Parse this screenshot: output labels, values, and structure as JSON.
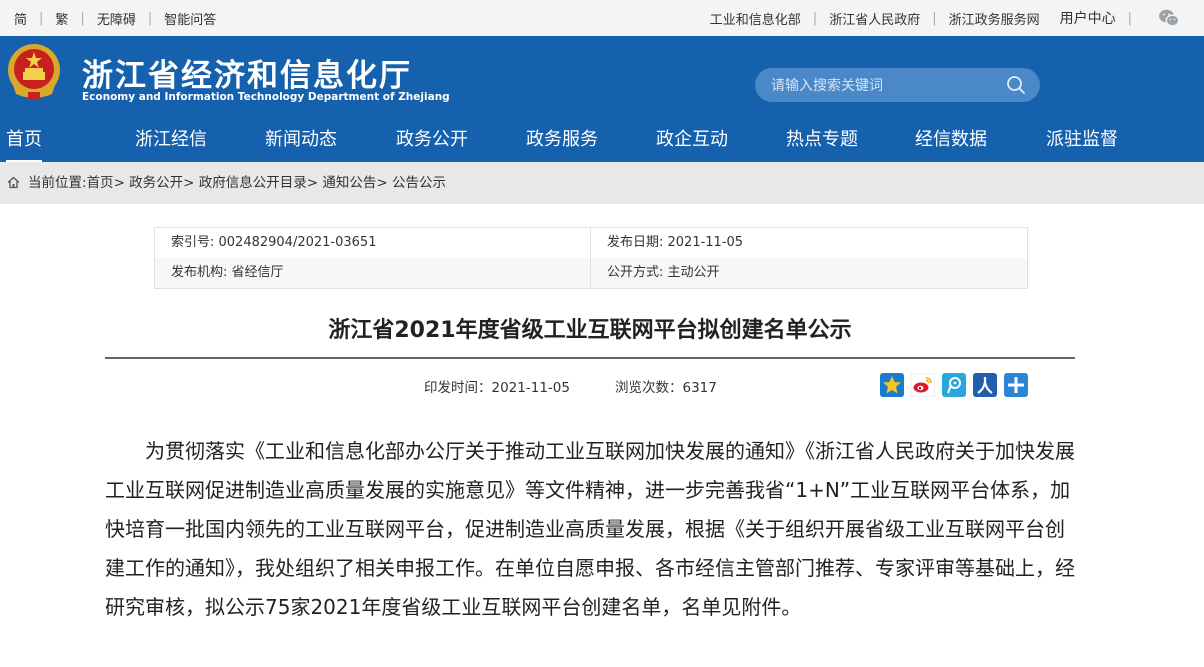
{
  "topbar": {
    "simplified": "简",
    "traditional": "繁",
    "accessibility": "无障碍",
    "smart_qa": "智能问答",
    "link_miit": "工业和信息化部",
    "link_zj_gov": "浙江省人民政府",
    "link_zj_service": "浙江政务服务网",
    "user_center": "用户中心"
  },
  "header": {
    "title": "浙江省经济和信息化厅",
    "subtitle": "Economy and Information Technology Department of Zhejiang",
    "search_placeholder": "请输入搜索关键词"
  },
  "nav": {
    "items": [
      "首页",
      "浙江经信",
      "新闻动态",
      "政务公开",
      "政务服务",
      "政企互动",
      "热点专题",
      "经信数据",
      "派驻监督"
    ]
  },
  "breadcrumb": {
    "prefix": "当前位置:",
    "items": [
      "首页",
      "政务公开",
      "政府信息公开目录",
      "通知公告",
      "公告公示"
    ]
  },
  "meta": {
    "index_no": "索引号: 002482904/2021-03651",
    "publish_date": "发布日期: 2021-11-05",
    "issuer": "发布机构: 省经信厅",
    "disclosure": "公开方式: 主动公开"
  },
  "article": {
    "title": "浙江省2021年度省级工业互联网平台拟创建名单公示",
    "issued_time": "印发时间：2021-11-05",
    "views": "浏览次数：6317",
    "body": "为贯彻落实《工业和信息化部办公厅关于推动工业互联网加快发展的通知》《浙江省人民政府关于加快发展工业互联网促进制造业高质量发展的实施意见》等文件精神，进一步完善我省“1+N”工业互联网平台体系，加快培育一批国内领先的工业互联网平台，促进制造业高质量发展，根据《关于组织开展省级工业互联网平台创建工作的通知》，我处组织了相关申报工作。在单位自愿申报、各市经信主管部门推荐、专家评审等基础上，经研究审核，拟公示75家2021年度省级工业互联网平台创建名单，名单见附件。"
  },
  "share_icons": [
    "qzone-icon",
    "weibo-icon",
    "tencent-weibo-icon",
    "renren-icon",
    "more-share-icon"
  ],
  "colors": {
    "header_blue": "#1661ad",
    "search_bg": "#4a88c8",
    "crumb_bg": "#e8e8e8"
  }
}
